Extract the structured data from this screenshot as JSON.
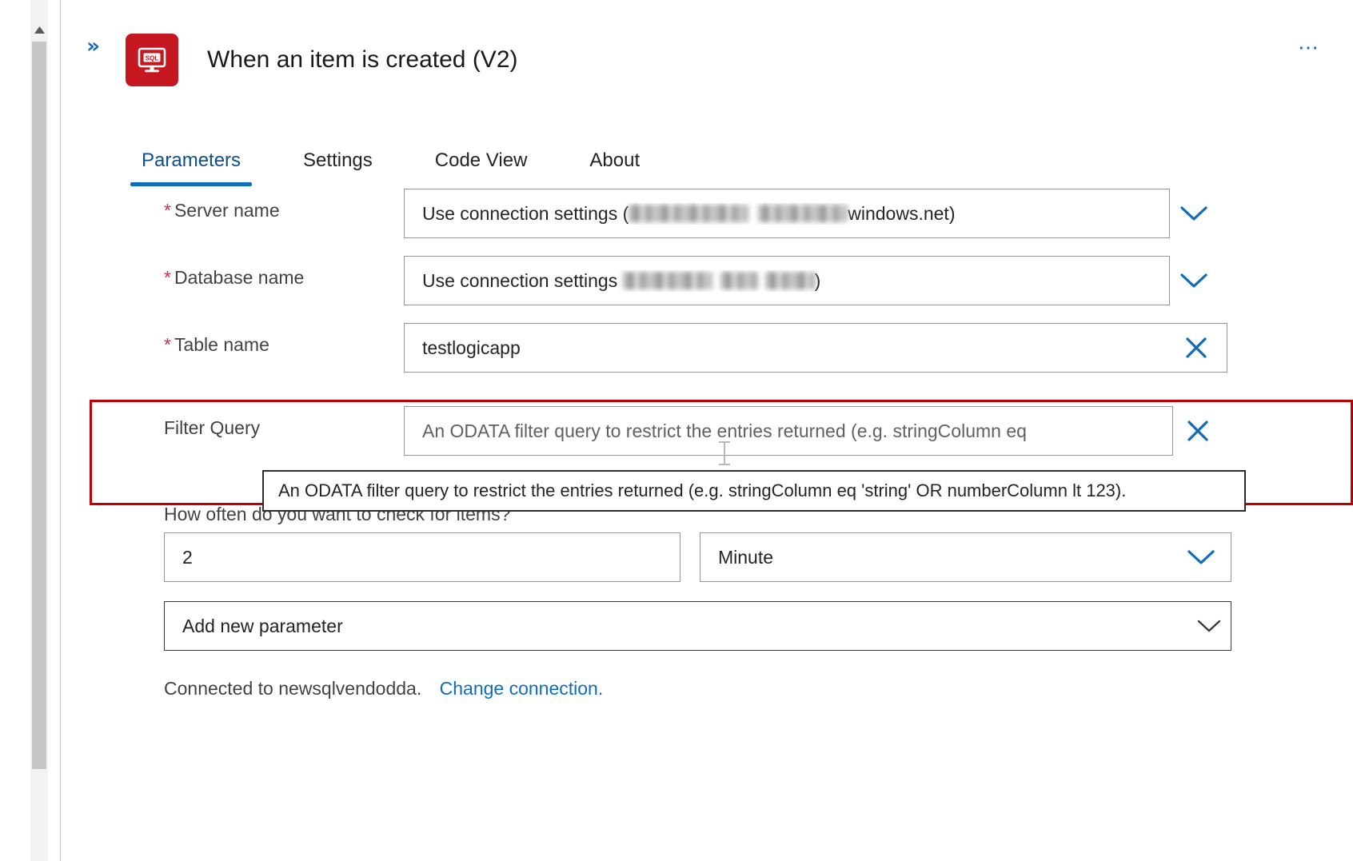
{
  "window": {
    "collapse_icon": "chevron-double-right-icon",
    "more_menu_label": "⋯",
    "app_icon": "sql-server-icon",
    "brand_color": "#c4171f",
    "accent_color": "#0f6cbd",
    "required_color": "#c4314b",
    "highlight_color": "#c00000",
    "title": "When an item is created (V2)"
  },
  "tabs": [
    {
      "label": "Parameters",
      "active": true
    },
    {
      "label": "Settings",
      "active": false
    },
    {
      "label": "Code View",
      "active": false
    },
    {
      "label": "About",
      "active": false
    }
  ],
  "fields": {
    "server_name": {
      "label": "Server name",
      "required": true,
      "value_prefix": "Use connection settings (",
      "value_suffix": "windows.net)",
      "redacted": true,
      "action_icon": "chevron-down-icon"
    },
    "database_name": {
      "label": "Database name",
      "required": true,
      "value_prefix": "Use connection settings ",
      "value_suffix": ")",
      "redacted": true,
      "action_icon": "chevron-down-icon"
    },
    "table_name": {
      "label": "Table name",
      "required": true,
      "value": "testlogicapp",
      "action_icon": "close-icon"
    },
    "filter_query": {
      "label": "Filter Query",
      "required": false,
      "placeholder": "An ODATA filter query to restrict the entries returned (e.g. stringColumn eq",
      "action_icon": "close-icon",
      "highlighted": true
    }
  },
  "tooltip": {
    "text": "An ODATA filter query to restrict the entries returned (e.g. stringColumn eq 'string' OR numberColumn lt 123)."
  },
  "recurrence": {
    "question": "How often do you want to check for items?",
    "interval_value": "2",
    "frequency_value": "Minute",
    "frequency_icon": "chevron-down-icon"
  },
  "add_parameter": {
    "label": "Add new parameter",
    "icon": "chevron-down-icon"
  },
  "connection": {
    "status_text": "Connected to newsqlvendodda.",
    "change_link": "Change connection."
  },
  "scrollbar": {
    "up_arrow_icon": "triangle-up-icon"
  }
}
